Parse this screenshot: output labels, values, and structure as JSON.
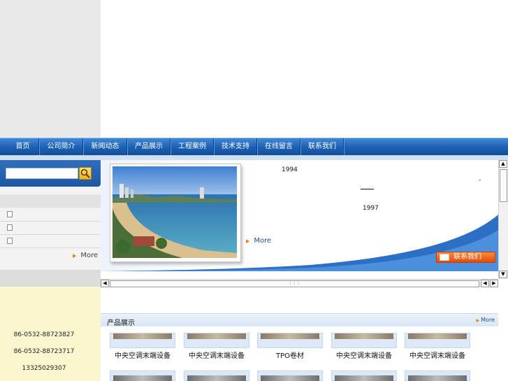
{
  "nav": {
    "items": [
      {
        "label": "首页"
      },
      {
        "label": "公司简介"
      },
      {
        "label": "新闻动态"
      },
      {
        "label": "产品展示"
      },
      {
        "label": "工程案例"
      },
      {
        "label": "技术支持"
      },
      {
        "label": "在线留言"
      },
      {
        "label": "联系我们"
      }
    ]
  },
  "search": {
    "placeholder": ""
  },
  "sidebar": {
    "more": "More",
    "phones": [
      "86-0532-88723827",
      "86-0532-88723717",
      "13325029307"
    ]
  },
  "banner": {
    "year1": "1994",
    "dash": "-",
    "year2": "1997",
    "more": "More",
    "contact_button": "联系我们"
  },
  "products": {
    "title": "产品展示",
    "more": "More",
    "items": [
      {
        "label": "中央空调末端设备"
      },
      {
        "label": "中央空调末端设备"
      },
      {
        "label": "TPO卷材"
      },
      {
        "label": "中央空调末端设备"
      },
      {
        "label": "中央空调末端设备"
      }
    ]
  },
  "colors": {
    "nav": "#1c5fb4",
    "accent": "#e87a10",
    "contact_panel": "#fbf6cf"
  }
}
